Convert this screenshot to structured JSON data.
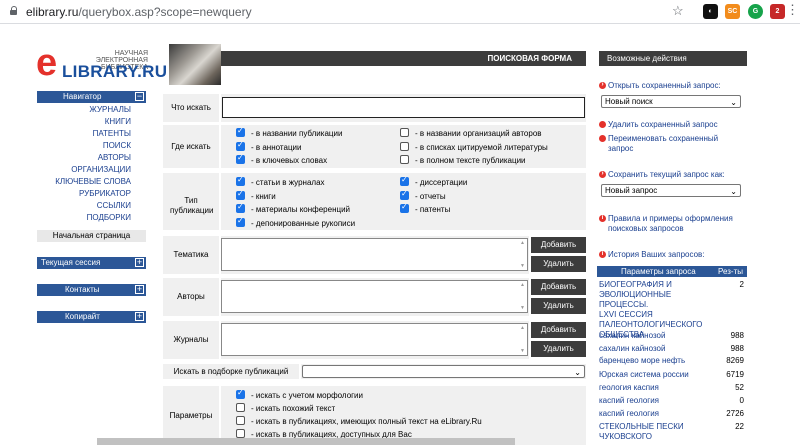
{
  "browser": {
    "url_host": "elibrary.ru",
    "url_path": "/querybox.asp?scope=newquery",
    "ext_badges": [
      "SC",
      "2"
    ]
  },
  "logo": {
    "line1": "НАУЧНАЯ ЭЛЕКТРОННАЯ",
    "line2": "БИБЛИОТЕКА",
    "letter": "e",
    "word": "LIBRARY.RU",
    "colors": {
      "red": "#e4312b",
      "blue": "#1a4f9c"
    }
  },
  "nav": {
    "title": "Навигатор",
    "items": [
      "ЖУРНАЛЫ",
      "КНИГИ",
      "ПАТЕНТЫ",
      "ПОИСК",
      "АВТОРЫ",
      "ОРГАНИЗАЦИИ",
      "КЛЮЧЕВЫЕ СЛОВА",
      "РУБРИКАТОР",
      "ССЫЛКИ",
      "ПОДБОРКИ"
    ],
    "home": "Начальная страница",
    "session": "Текущая сессия",
    "contacts": "Контакты",
    "copyright": "Копирайт",
    "collapse_sym": "−",
    "expand_sym": "+"
  },
  "form": {
    "title": "ПОИСКОВАЯ ФОРМА",
    "what_label": "Что искать",
    "where_label": "Где искать",
    "where_options": [
      {
        "label": "- в названии публикации",
        "checked": true
      },
      {
        "label": "- в названии организаций авторов",
        "checked": false
      },
      {
        "label": "- в аннотации",
        "checked": true
      },
      {
        "label": "- в списках цитируемой литературы",
        "checked": false
      },
      {
        "label": "- в ключевых словах",
        "checked": true
      },
      {
        "label": "- в полном тексте публикации",
        "checked": false
      }
    ],
    "type_label": "Тип публикации",
    "type_options": [
      {
        "label": "- статьи в журналах",
        "checked": true
      },
      {
        "label": "- диссертации",
        "checked": true
      },
      {
        "label": "- книги",
        "checked": true
      },
      {
        "label": "- отчеты",
        "checked": true
      },
      {
        "label": "- материалы конференций",
        "checked": true
      },
      {
        "label": "- патенты",
        "checked": true
      },
      {
        "label": "- депонированные рукописи",
        "checked": true
      }
    ],
    "topic_label": "Тематика",
    "authors_label": "Авторы",
    "journals_label": "Журналы",
    "add_label": "Добавить",
    "remove_label": "Удалить",
    "collection_label": "Искать в подборке публикаций",
    "params_label": "Параметры",
    "params_options": [
      {
        "label": "- искать с учетом морфологии",
        "checked": true
      },
      {
        "label": "- искать похожий текст",
        "checked": false
      },
      {
        "label": "- искать в публикациях, имеющих полный текст на eLibrary.Ru",
        "checked": false
      },
      {
        "label": "- искать в публикациях, доступных для Вас",
        "checked": false
      }
    ]
  },
  "right": {
    "title": "Возможные действия",
    "open_saved": "Открыть сохраненный запрос:",
    "new_search": "Новый поиск",
    "delete_saved": "Удалить сохраненный запрос",
    "rename_saved_1": "Переименовать сохраненный",
    "rename_saved_2": "запрос",
    "save_current": "Сохранить текущий запрос как:",
    "new_query": "Новый запрос",
    "rules_1": "Правила и примеры оформления",
    "rules_2": "поисковых запросов",
    "history": "История Ваших запросов:",
    "col_params": "Параметры запроса",
    "col_results": "Рез-ты",
    "history_rows": [
      {
        "q1": "БИОГЕОГРАФИЯ И",
        "q2": "ЭВОЛЮЦИОННЫЕ ПРОЦЕССЫ.",
        "q3": "LXVI СЕССИЯ",
        "q4": "ПАЛЕОНТОЛОГИЧЕСКОГО",
        "q5": "ОБЩЕСТВА",
        "n": "2"
      },
      {
        "q": "сахалин кайнозой",
        "n": "988"
      },
      {
        "q": "сахалин кайнозой",
        "n": "988"
      },
      {
        "q": "баренцево море нефть",
        "n": "8269"
      },
      {
        "q": "Юрская система россии",
        "n": "6719"
      },
      {
        "q": "геология каспия",
        "n": "52"
      },
      {
        "q": "каспий геология",
        "n": "0"
      },
      {
        "q": "каспий геология",
        "n": "2726"
      },
      {
        "q": "СТЕКОЛЬНЫЕ ПЕСКИ",
        "n": "22"
      },
      {
        "q": "ЧУКОВСКОГО",
        "n": ""
      }
    ]
  }
}
